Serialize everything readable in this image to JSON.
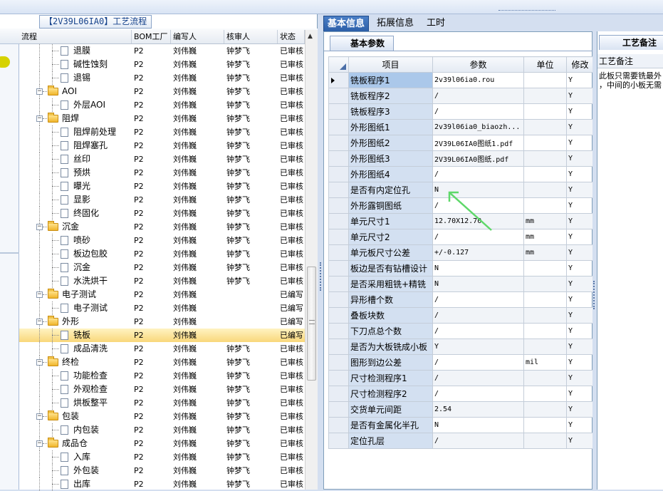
{
  "window": {
    "left_title": "【2V39L06IA0】工艺流程"
  },
  "left_grid": {
    "columns": [
      "流程",
      "BOM工厂",
      "编写人",
      "核审人",
      "状态"
    ],
    "rows": [
      {
        "label": "退膜",
        "level": 2,
        "bom": "P2",
        "writer": "刘伟巍",
        "reviewer": "钟梦飞",
        "status": "已审核"
      },
      {
        "label": "碱性蚀刻",
        "level": 2,
        "bom": "P2",
        "writer": "刘伟巍",
        "reviewer": "钟梦飞",
        "status": "已审核"
      },
      {
        "label": "退锡",
        "level": 2,
        "bom": "P2",
        "writer": "刘伟巍",
        "reviewer": "钟梦飞",
        "status": "已审核"
      },
      {
        "label": "AOI",
        "level": 1,
        "bom": "P2",
        "writer": "刘伟巍",
        "reviewer": "钟梦飞",
        "status": "已审核"
      },
      {
        "label": "外层AOI",
        "level": 2,
        "bom": "P2",
        "writer": "刘伟巍",
        "reviewer": "钟梦飞",
        "status": "已审核"
      },
      {
        "label": "阻焊",
        "level": 1,
        "bom": "P2",
        "writer": "刘伟巍",
        "reviewer": "钟梦飞",
        "status": "已审核"
      },
      {
        "label": "阻焊前处理",
        "level": 2,
        "bom": "P2",
        "writer": "刘伟巍",
        "reviewer": "钟梦飞",
        "status": "已审核"
      },
      {
        "label": "阻焊塞孔",
        "level": 2,
        "bom": "P2",
        "writer": "刘伟巍",
        "reviewer": "钟梦飞",
        "status": "已审核"
      },
      {
        "label": "丝印",
        "level": 2,
        "bom": "P2",
        "writer": "刘伟巍",
        "reviewer": "钟梦飞",
        "status": "已审核"
      },
      {
        "label": "预烘",
        "level": 2,
        "bom": "P2",
        "writer": "刘伟巍",
        "reviewer": "钟梦飞",
        "status": "已审核"
      },
      {
        "label": "曝光",
        "level": 2,
        "bom": "P2",
        "writer": "刘伟巍",
        "reviewer": "钟梦飞",
        "status": "已审核"
      },
      {
        "label": "显影",
        "level": 2,
        "bom": "P2",
        "writer": "刘伟巍",
        "reviewer": "钟梦飞",
        "status": "已审核"
      },
      {
        "label": "终固化",
        "level": 2,
        "bom": "P2",
        "writer": "刘伟巍",
        "reviewer": "钟梦飞",
        "status": "已审核"
      },
      {
        "label": "沉金",
        "level": 1,
        "bom": "P2",
        "writer": "刘伟巍",
        "reviewer": "钟梦飞",
        "status": "已审核"
      },
      {
        "label": "喷砂",
        "level": 2,
        "bom": "P2",
        "writer": "刘伟巍",
        "reviewer": "钟梦飞",
        "status": "已审核"
      },
      {
        "label": "板边包胶",
        "level": 2,
        "bom": "P2",
        "writer": "刘伟巍",
        "reviewer": "钟梦飞",
        "status": "已审核"
      },
      {
        "label": "沉金",
        "level": 2,
        "bom": "P2",
        "writer": "刘伟巍",
        "reviewer": "钟梦飞",
        "status": "已审核"
      },
      {
        "label": "水洗烘干",
        "level": 2,
        "bom": "P2",
        "writer": "刘伟巍",
        "reviewer": "钟梦飞",
        "status": "已审核"
      },
      {
        "label": "电子测试",
        "level": 1,
        "bom": "P2",
        "writer": "刘伟巍",
        "reviewer": "",
        "status": "已编写"
      },
      {
        "label": "电子测试",
        "level": 2,
        "bom": "P2",
        "writer": "刘伟巍",
        "reviewer": "",
        "status": "已编写"
      },
      {
        "label": "外形",
        "level": 1,
        "bom": "P2",
        "writer": "刘伟巍",
        "reviewer": "",
        "status": "已编写"
      },
      {
        "label": "铣板",
        "level": 2,
        "bom": "P2",
        "writer": "刘伟巍",
        "reviewer": "",
        "status": "已编写",
        "selected": true
      },
      {
        "label": "成品清洗",
        "level": 2,
        "bom": "P2",
        "writer": "刘伟巍",
        "reviewer": "钟梦飞",
        "status": "已审核"
      },
      {
        "label": "终检",
        "level": 1,
        "bom": "P2",
        "writer": "刘伟巍",
        "reviewer": "钟梦飞",
        "status": "已审核"
      },
      {
        "label": "功能检查",
        "level": 2,
        "bom": "P2",
        "writer": "刘伟巍",
        "reviewer": "钟梦飞",
        "status": "已审核"
      },
      {
        "label": "外观检查",
        "level": 2,
        "bom": "P2",
        "writer": "刘伟巍",
        "reviewer": "钟梦飞",
        "status": "已审核"
      },
      {
        "label": "烘板整平",
        "level": 2,
        "bom": "P2",
        "writer": "刘伟巍",
        "reviewer": "钟梦飞",
        "status": "已审核"
      },
      {
        "label": "包装",
        "level": 1,
        "bom": "P2",
        "writer": "刘伟巍",
        "reviewer": "钟梦飞",
        "status": "已审核"
      },
      {
        "label": "内包装",
        "level": 2,
        "bom": "P2",
        "writer": "刘伟巍",
        "reviewer": "钟梦飞",
        "status": "已审核"
      },
      {
        "label": "成品仓",
        "level": 1,
        "bom": "P2",
        "writer": "刘伟巍",
        "reviewer": "钟梦飞",
        "status": "已审核"
      },
      {
        "label": "入库",
        "level": 2,
        "bom": "P2",
        "writer": "刘伟巍",
        "reviewer": "钟梦飞",
        "status": "已审核"
      },
      {
        "label": "外包装",
        "level": 2,
        "bom": "P2",
        "writer": "刘伟巍",
        "reviewer": "钟梦飞",
        "status": "已审核"
      },
      {
        "label": "出库",
        "level": 2,
        "bom": "P2",
        "writer": "刘伟巍",
        "reviewer": "钟梦飞",
        "status": "已审核"
      }
    ]
  },
  "tabs": [
    "基本信息",
    "拓展信息",
    "工时"
  ],
  "subtab": "基本参数",
  "param_table": {
    "columns": [
      "项目",
      "参数",
      "单位",
      "修改"
    ],
    "rows": [
      {
        "name": "铣板程序1",
        "value": "2v39l06ia0.rou",
        "unit": "",
        "flag": "Y"
      },
      {
        "name": "铣板程序2",
        "value": "/",
        "unit": "",
        "flag": "Y"
      },
      {
        "name": "铣板程序3",
        "value": "/",
        "unit": "",
        "flag": "Y"
      },
      {
        "name": "外形图纸1",
        "value": "2v39l06ia0_biaozh...",
        "unit": "",
        "flag": "Y"
      },
      {
        "name": "外形图纸2",
        "value": "2V39L06IA0图纸1.pdf",
        "unit": "",
        "flag": "Y"
      },
      {
        "name": "外形图纸3",
        "value": "2V39L06IA0图纸.pdf",
        "unit": "",
        "flag": "Y"
      },
      {
        "name": "外形图纸4",
        "value": "/",
        "unit": "",
        "flag": "Y"
      },
      {
        "name": "是否有内定位孔",
        "value": "N",
        "unit": "",
        "flag": "Y"
      },
      {
        "name": "外形露铜图纸",
        "value": "/",
        "unit": "",
        "flag": "Y"
      },
      {
        "name": "单元尺寸1",
        "value": "12.70X12.70",
        "unit": "mm",
        "flag": "Y"
      },
      {
        "name": "单元尺寸2",
        "value": "/",
        "unit": "mm",
        "flag": "Y"
      },
      {
        "name": "单元板尺寸公差",
        "value": "+/-0.127",
        "unit": "mm",
        "flag": "Y"
      },
      {
        "name": "板边是否有钻槽设计",
        "value": "N",
        "unit": "",
        "flag": "Y"
      },
      {
        "name": "是否采用粗铣+精铣",
        "value": "N",
        "unit": "",
        "flag": "Y"
      },
      {
        "name": "异形槽个数",
        "value": "/",
        "unit": "",
        "flag": "Y"
      },
      {
        "name": "叠板块数",
        "value": "/",
        "unit": "",
        "flag": "Y"
      },
      {
        "name": "下刀点总个数",
        "value": "/",
        "unit": "",
        "flag": "Y"
      },
      {
        "name": "是否为大板铣成小板",
        "value": "Y",
        "unit": "",
        "flag": "Y"
      },
      {
        "name": "图形到边公差",
        "value": "/",
        "unit": "mil",
        "flag": "Y"
      },
      {
        "name": "尺寸检测程序1",
        "value": "/",
        "unit": "",
        "flag": "Y"
      },
      {
        "name": "尺寸检测程序2",
        "value": "/",
        "unit": "",
        "flag": "Y"
      },
      {
        "name": "交货单元间距",
        "value": "2.54",
        "unit": "",
        "flag": "Y"
      },
      {
        "name": "是否有金属化半孔",
        "value": "N",
        "unit": "",
        "flag": "Y"
      },
      {
        "name": "定位孔层",
        "value": "/",
        "unit": "",
        "flag": "Y"
      }
    ]
  },
  "notes": {
    "tab": "工艺备注",
    "header": "工艺备注",
    "text_line1": "此板只需要铣最外",
    "text_line2": "，中间的小板无需"
  },
  "colors": {
    "accent": "#2c5fa8",
    "selected_row": "#f9d77a",
    "annotation_arrow": "#5fd86a"
  }
}
